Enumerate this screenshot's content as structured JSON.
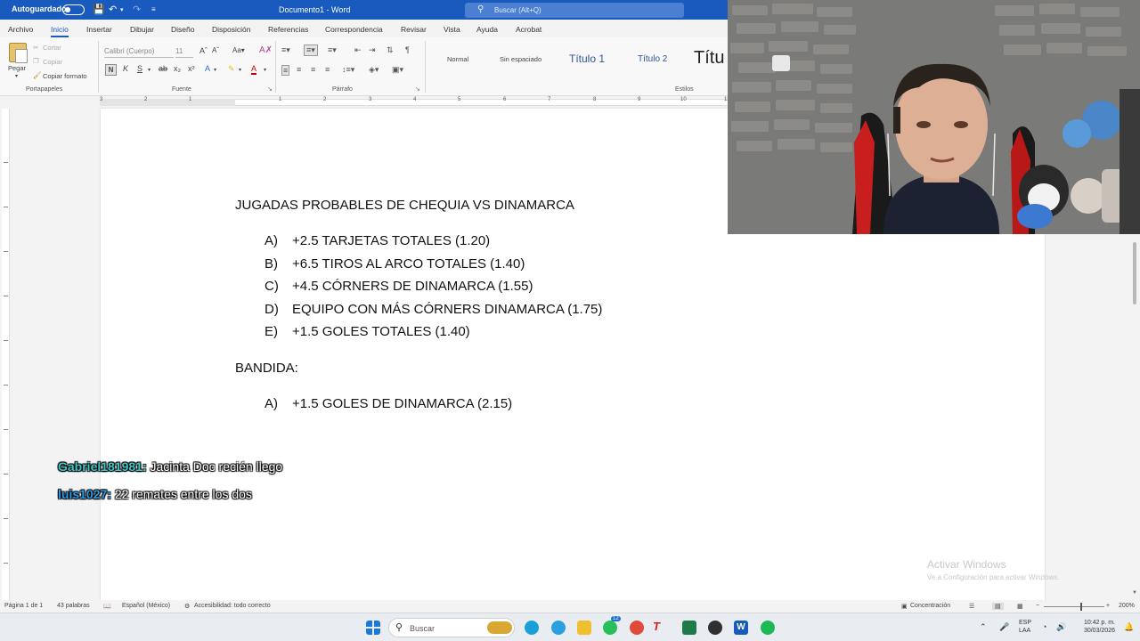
{
  "titlebar": {
    "autosave_label": "Autoguardado",
    "doc_title": "Documento1 - Word",
    "search_placeholder": "Buscar (Alt+Q)"
  },
  "ribbon_tabs": [
    "Archivo",
    "Inicio",
    "Insertar",
    "Dibujar",
    "Diseño",
    "Disposición",
    "Referencias",
    "Correspondencia",
    "Revisar",
    "Vista",
    "Ayuda",
    "Acrobat"
  ],
  "active_tab": "Inicio",
  "clipboard": {
    "paste": "Pegar",
    "cut": "Cortar",
    "copy": "Copiar",
    "format_painter": "Copiar formato",
    "group": "Portapapeles"
  },
  "font": {
    "name": "Calibri (Cuerpo)",
    "size": "11",
    "bold_label": "N",
    "italic_label": "K",
    "underline_label": "S",
    "group": "Fuente"
  },
  "paragraph": {
    "group": "Párrafo"
  },
  "styles": {
    "items": [
      "Normal",
      "Sin espaciado",
      "Título 1",
      "Título 2",
      "Títu"
    ],
    "group": "Estilos"
  },
  "ruler_numbers": [
    "3",
    "2",
    "1",
    "1",
    "2",
    "3",
    "4",
    "5",
    "6",
    "7",
    "8",
    "9",
    "10",
    "11"
  ],
  "document": {
    "title": "JUGADAS PROBABLES DE CHEQUIA VS DINAMARCA",
    "bets": [
      {
        "letter": "A)",
        "text": "+2.5 TARJETAS TOTALES (1.20)"
      },
      {
        "letter": "B)",
        "text": "+6.5 TIROS AL ARCO TOTALES (1.40)"
      },
      {
        "letter": "C)",
        "text": "+4.5 CÓRNERS DE DINAMARCA (1.55)"
      },
      {
        "letter": "D)",
        "text": "EQUIPO CON MÁS CÓRNERS DINAMARCA (1.75)"
      },
      {
        "letter": "E)",
        "text": "+1.5 GOLES TOTALES (1.40)"
      }
    ],
    "bandida_heading": "BANDIDA:",
    "bandida_bets": [
      {
        "letter": "A)",
        "text": "+1.5 GOLES DE DINAMARCA (2.15)"
      }
    ]
  },
  "chat": [
    {
      "user": "Gabriel181981:",
      "message": "Jacinta Doc recién llego",
      "color": "#3cc8c8"
    },
    {
      "user": "luis1027:",
      "message": "22 remates entre los dos",
      "color": "#2e9be6"
    }
  ],
  "watermark": {
    "line1": "Activar Windows",
    "line2": "Ve a Configuración para activar Windows."
  },
  "statusbar": {
    "page": "Página 1 de 1",
    "words": "43 palabras",
    "language": "Español (México)",
    "accessibility": "Accesibilidad: todo correcto",
    "focus": "Concentración",
    "zoom": "200%"
  },
  "taskbar": {
    "search_placeholder": "Buscar",
    "lang_line1": "ESP",
    "lang_line2": "LAA",
    "time": "10:42 p. m.",
    "date": "30/03/2026",
    "whatsapp_badge": "12"
  },
  "colors": {
    "word_blue": "#185abd",
    "chat_user1": "#3cc8c8",
    "chat_user2": "#2e9be6"
  }
}
